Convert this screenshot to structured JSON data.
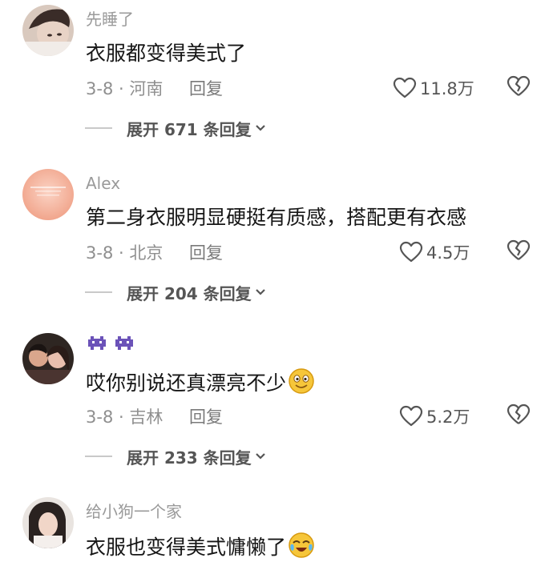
{
  "comments": [
    {
      "username": "先睡了",
      "text": "衣服都变得美式了",
      "meta": "3-8 · 河南",
      "reply_label": "回复",
      "likes": "11.8万",
      "expand_label": "展开 671 条回复"
    },
    {
      "username": "Alex",
      "text": "第二身衣服明显硬挺有质感，搭配更有衣感",
      "meta": "3-8 · 北京",
      "reply_label": "回复",
      "likes": "4.5万",
      "expand_label": "展开 204 条回复"
    },
    {
      "username_emoji": "alien-monster-icon ×2",
      "text": "哎你别说还真漂亮不少",
      "meta": "3-8 · 吉林",
      "reply_label": "回复",
      "likes": "5.2万",
      "expand_label": "展开 233 条回复"
    },
    {
      "username": "给小狗一个家",
      "text": "衣服也变得美式慵懒了",
      "meta": "",
      "reply_label": "",
      "likes": "",
      "expand_label": ""
    }
  ],
  "icons": {
    "like": "heart-outline-icon",
    "dislike": "broken-heart-icon",
    "expand": "chevron-down-icon",
    "emoji_smile": "smiling-face-icon",
    "emoji_cry": "crying-laughing-face-icon"
  },
  "colors": {
    "username": "#9a9a9a",
    "text": "#161616",
    "meta": "#8f8f8f",
    "badge_purple": "#6b52b8"
  }
}
